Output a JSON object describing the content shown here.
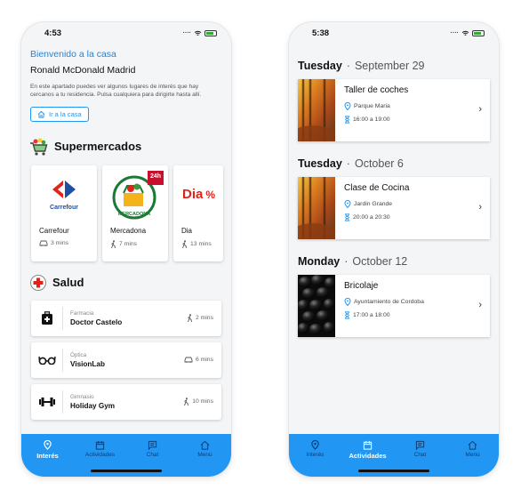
{
  "phone1": {
    "time": "4:53",
    "welcome_title": "Bienvenido a la casa",
    "house_name": "Ronald McDonald Madrid",
    "description": "En este apartado puedes ver algunos lugares de interés que hay cercanos a tu residencia. Pulsa cualquiera para dirigirte hasta allí.",
    "go_home_label": "Ir a la casa",
    "supermarkets_title": "Supermercados",
    "supermarkets": [
      {
        "name": "Carrefour",
        "time": "3 mins",
        "mode": "car",
        "logo_text": "Carrefour"
      },
      {
        "name": "Mercadona",
        "time": "7 mins",
        "mode": "walk",
        "logo_text": "MERCADONA",
        "badge": "24h"
      },
      {
        "name": "Dia",
        "time": "13 mins",
        "mode": "walk",
        "logo_text": "Dia"
      }
    ],
    "health_title": "Salud",
    "health": [
      {
        "category": "Farmacia",
        "name": "Doctor Castelo",
        "time": "2 mins",
        "mode": "walk",
        "icon": "first-aid-kit-icon"
      },
      {
        "category": "Óptica",
        "name": "VisionLab",
        "time": "6 mins",
        "mode": "car",
        "icon": "glasses-icon"
      },
      {
        "category": "Gimnasio",
        "name": "Holiday Gym",
        "time": "10 mins",
        "mode": "walk",
        "icon": "dumbbell-icon"
      }
    ],
    "tabs": [
      "Interés",
      "Actividades",
      "Chat",
      "Menú"
    ],
    "active_tab": 0
  },
  "phone2": {
    "time": "5:38",
    "days": [
      {
        "weekday": "Tuesday",
        "date": "September 29",
        "activity": {
          "title": "Taller de coches",
          "place": "Parque Maria",
          "hours": "16:00 a 19:00",
          "image": "autumn-forest"
        }
      },
      {
        "weekday": "Tuesday",
        "date": "October 6",
        "activity": {
          "title": "Clase de Cocina",
          "place": "Jardin Grande",
          "hours": "20:00 a 20:30",
          "image": "autumn-forest"
        }
      },
      {
        "weekday": "Monday",
        "date": "October 12",
        "activity": {
          "title": "Bricolaje",
          "place": "Ayuntamiento de Cordoba",
          "hours": "17:00 a 18:00",
          "image": "black-stones"
        }
      }
    ],
    "tabs": [
      "Interés",
      "Actividades",
      "Chat",
      "Menú"
    ],
    "active_tab": 1
  },
  "colors": {
    "accent": "#2196f3",
    "link": "#2583d6",
    "tab_inactive": "#0c3f7a"
  }
}
